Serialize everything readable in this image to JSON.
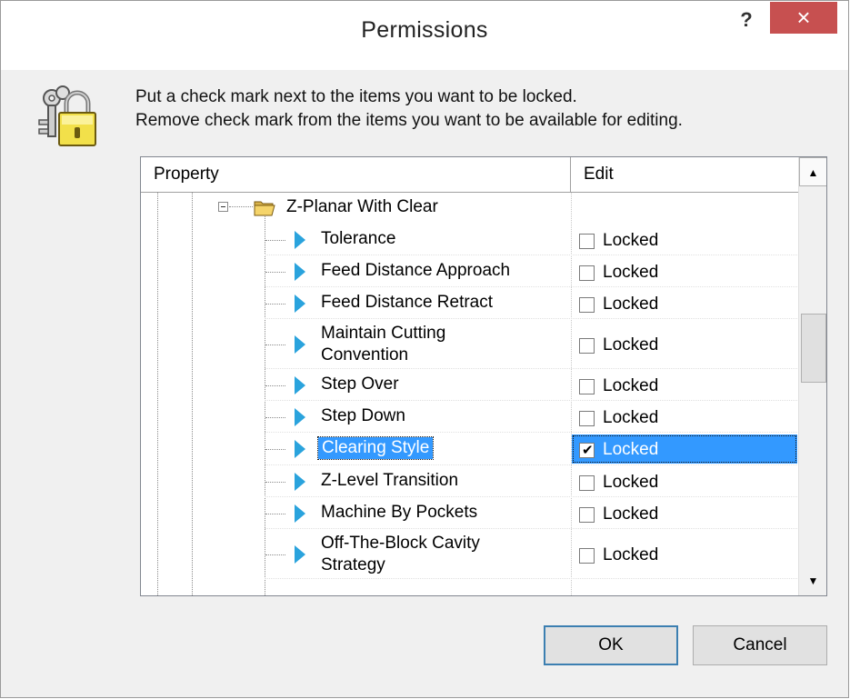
{
  "window": {
    "title": "Permissions",
    "help_label": "?",
    "close_label": "×"
  },
  "instructions": {
    "line1": "Put a check mark next to the items you want to be locked.",
    "line2": "Remove check mark from the items you want to be available for editing."
  },
  "grid": {
    "columns": {
      "property": "Property",
      "edit": "Edit"
    },
    "group": {
      "label": "Z-Planar With Clear",
      "expanded": true
    },
    "rows": [
      {
        "label": "Tolerance",
        "edit_label": "Locked",
        "checked": false,
        "selected": false
      },
      {
        "label": "Feed Distance Approach",
        "edit_label": "Locked",
        "checked": false,
        "selected": false
      },
      {
        "label": "Feed Distance Retract",
        "edit_label": "Locked",
        "checked": false,
        "selected": false
      },
      {
        "label_lines": [
          "Maintain Cutting",
          "Convention"
        ],
        "edit_label": "Locked",
        "checked": false,
        "selected": false
      },
      {
        "label": "Step Over",
        "edit_label": "Locked",
        "checked": false,
        "selected": false
      },
      {
        "label": "Step Down",
        "edit_label": "Locked",
        "checked": false,
        "selected": false
      },
      {
        "label": "Clearing Style",
        "edit_label": "Locked",
        "checked": true,
        "selected": true
      },
      {
        "label": "Z-Level Transition",
        "edit_label": "Locked",
        "checked": false,
        "selected": false
      },
      {
        "label": "Machine By Pockets",
        "edit_label": "Locked",
        "checked": false,
        "selected": false
      },
      {
        "label_lines": [
          "Off-The-Block Cavity",
          "Strategy"
        ],
        "edit_label": "Locked",
        "checked": false,
        "selected": false
      }
    ],
    "scrollbar": {
      "up_icon": "▲",
      "down_icon": "▼"
    }
  },
  "buttons": {
    "ok": "OK",
    "cancel": "Cancel"
  },
  "colors": {
    "selection": "#3399ff",
    "arrow": "#2aa3dd",
    "close_bg": "#c75050",
    "lock_body": "#f2e04a"
  },
  "icons": {
    "dialog": "lock-with-keys-icon",
    "group": "open-folder-icon",
    "item": "triangle-right-icon"
  }
}
